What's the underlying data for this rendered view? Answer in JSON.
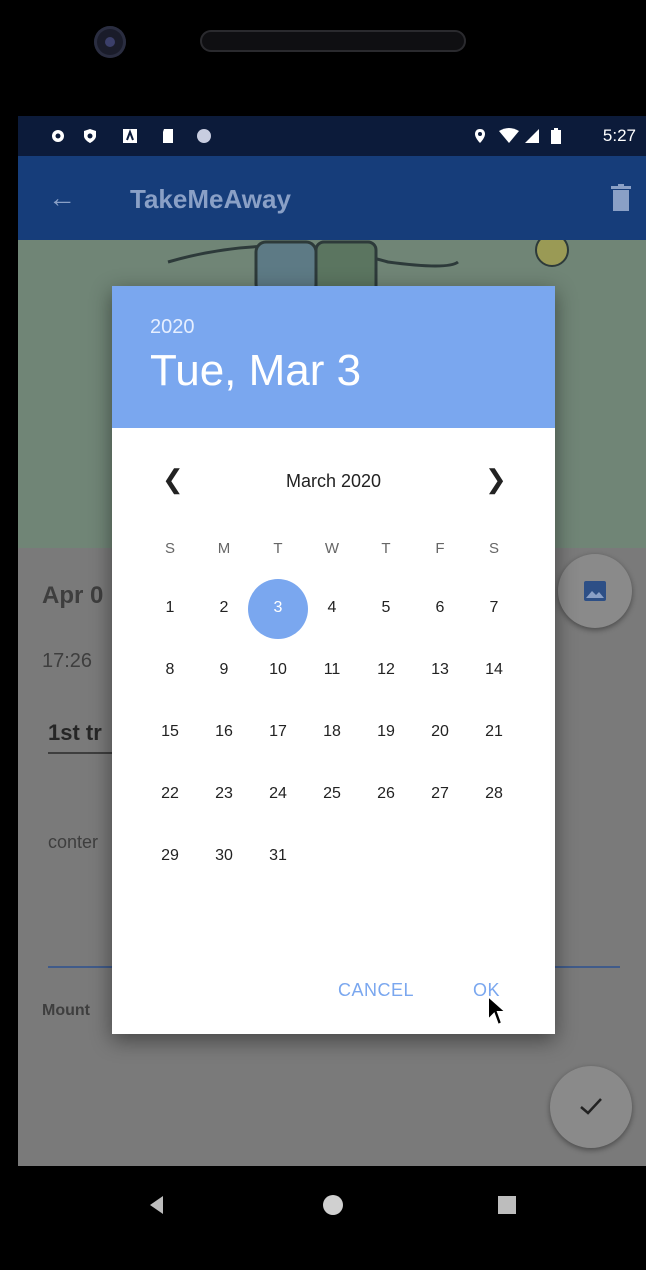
{
  "status_bar": {
    "time": "5:27"
  },
  "app_bar": {
    "back_icon": "arrow-left-icon",
    "title": "TakeMeAway",
    "delete_icon": "trash-icon"
  },
  "background": {
    "date_text": "Apr 0",
    "time_text": "17:26",
    "title_text": "1st tr",
    "content_text": "conter",
    "location_text": "Mount"
  },
  "date_picker": {
    "year": "2020",
    "selected_date": "Tue, Mar 3",
    "month_label": "March 2020",
    "prev_icon": "chevron-left-icon",
    "next_icon": "chevron-right-icon",
    "weekdays": [
      "S",
      "M",
      "T",
      "W",
      "T",
      "F",
      "S"
    ],
    "selected_day": 3,
    "days": [
      [
        "1",
        "2",
        "3",
        "4",
        "5",
        "6",
        "7"
      ],
      [
        "8",
        "9",
        "10",
        "11",
        "12",
        "13",
        "14"
      ],
      [
        "15",
        "16",
        "17",
        "18",
        "19",
        "20",
        "21"
      ],
      [
        "22",
        "23",
        "24",
        "25",
        "26",
        "27",
        "28"
      ],
      [
        "29",
        "30",
        "31"
      ]
    ],
    "cancel_label": "CANCEL",
    "ok_label": "OK",
    "accent_color": "#7aa7ef"
  },
  "nav_bar": {
    "back_icon": "triangle-back-icon",
    "home_icon": "circle-home-icon",
    "recents_icon": "square-recents-icon"
  }
}
